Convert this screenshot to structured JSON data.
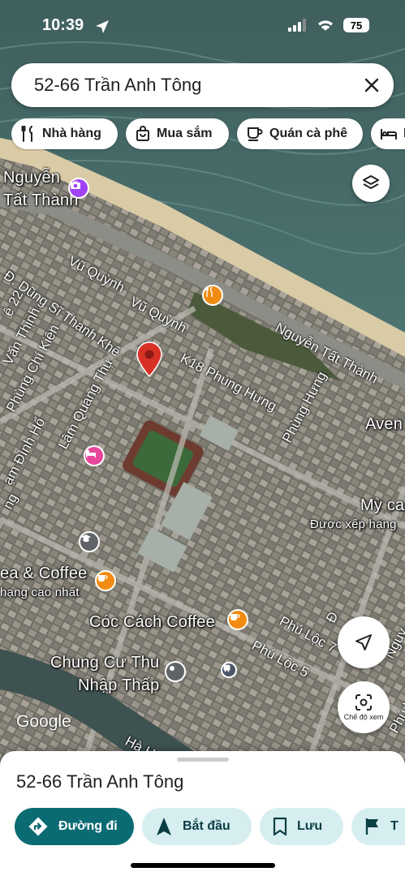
{
  "status_bar": {
    "time": "10:39",
    "battery": "75"
  },
  "search": {
    "query": "52-66 Trần Anh Tông"
  },
  "categories": [
    {
      "label": "Nhà hàng",
      "icon": "fork-knife-icon"
    },
    {
      "label": "Mua sắm",
      "icon": "shopping-bag-icon"
    },
    {
      "label": "Quán cà phê",
      "icon": "coffee-cup-icon"
    },
    {
      "label": "K",
      "icon": "bed-icon"
    }
  ],
  "map": {
    "place_labels": [
      {
        "text": "Nguyễn"
      },
      {
        "text": "Tất Thành"
      },
      {
        "text": "ea & Coffee"
      },
      {
        "text": "hạng cao nhất"
      },
      {
        "text": "Cóc Cách Coffee"
      },
      {
        "text": "Chung Cư Thu"
      },
      {
        "text": "Nhập Thấp"
      },
      {
        "text": "Mỳ ca"
      },
      {
        "text": "Được xếp hạng"
      },
      {
        "text": "Aven"
      }
    ],
    "street_labels": [
      {
        "text": "Vũ Quỳnh"
      },
      {
        "text": "Vũ Quỳnh"
      },
      {
        "text": "Nguyễn Tất Thành"
      },
      {
        "text": "Đ. Dũng Sĩ Thanh Khê"
      },
      {
        "text": "K18 Phùng Hưng"
      },
      {
        "text": "Phùng Hưng"
      },
      {
        "text": "Phùng Chí Kiên"
      },
      {
        "text": "Văn Thịnh"
      },
      {
        "text": "Lâm Quang Thự"
      },
      {
        "text": "ạm Đình Hổ"
      },
      {
        "text": "Phú Lộc 7"
      },
      {
        "text": "Phú Lộc 5"
      },
      {
        "text": "Hà H"
      },
      {
        "text": "Nguy"
      },
      {
        "text": "ê 22"
      },
      {
        "text": "Phú Lộ"
      },
      {
        "text": "ng"
      },
      {
        "text": "Đ"
      }
    ],
    "google_logo": "Google",
    "lens_label": "Chế độ xem",
    "accent_pin": "#d93025"
  },
  "place": {
    "title": "52-66 Trần Anh Tông"
  },
  "actions": [
    {
      "label": "Đường đi",
      "icon": "directions-icon"
    },
    {
      "label": "Bắt đầu",
      "icon": "navigation-arrow-icon"
    },
    {
      "label": "Lưu",
      "icon": "bookmark-icon"
    },
    {
      "label": "T",
      "icon": "flag-icon"
    }
  ]
}
